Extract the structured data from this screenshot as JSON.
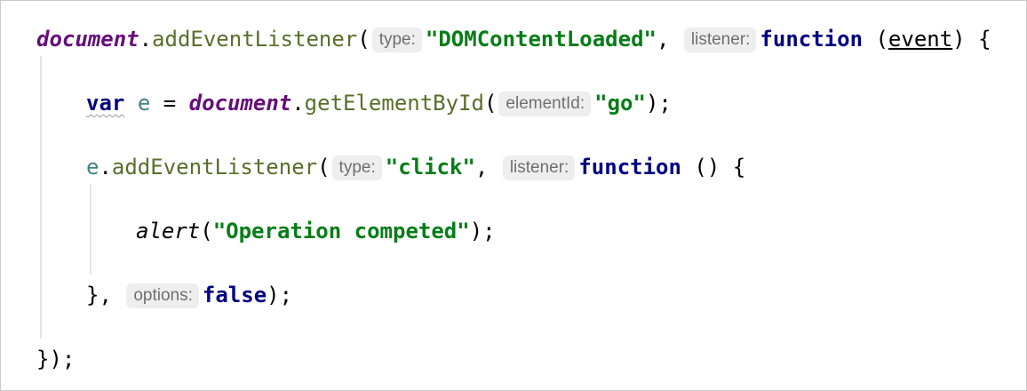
{
  "code": {
    "line1": {
      "obj": "document",
      "dot": ".",
      "method": "addEventListener",
      "open": "(",
      "hint_type": "type:",
      "type_value": "\"DOMContentLoaded\"",
      "comma": ",",
      "hint_listener": "listener:",
      "keyword_function": "function",
      "param_open": " (",
      "param": "event",
      "param_close": ") {"
    },
    "line2": {
      "keyword_var": "var",
      "var_name": "e",
      "assign": " = ",
      "obj": "document",
      "dot": ".",
      "method": "getElementById",
      "open": "(",
      "hint_element_id": "elementId:",
      "id_value": "\"go\"",
      "close": ");"
    },
    "line3": {
      "var_name": "e",
      "dot": ".",
      "method": "addEventListener",
      "open": "(",
      "hint_type": "type:",
      "type_value": "\"click\"",
      "comma": ",",
      "hint_listener": "listener:",
      "keyword_function": "function",
      "rest": " () {"
    },
    "line4": {
      "func": "alert",
      "open": "(",
      "message": "\"Operation competed\"",
      "close": ");"
    },
    "line5": {
      "close": "},",
      "hint_options": "options:",
      "keyword_false": "false",
      "end": ");"
    },
    "line6": {
      "close": "});"
    }
  }
}
